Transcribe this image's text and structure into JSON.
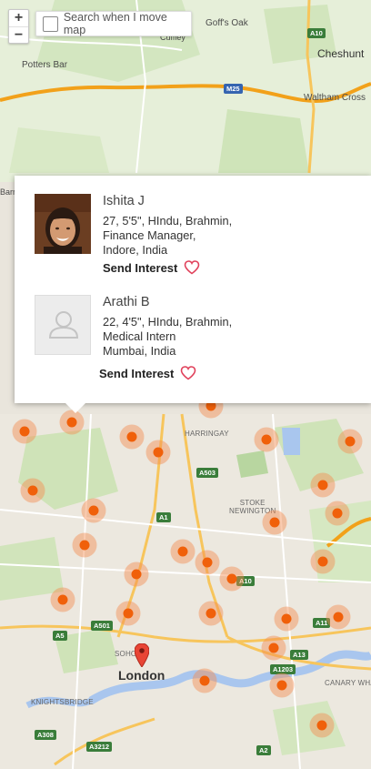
{
  "map_controls": {
    "zoom_in": "+",
    "zoom_out": "−"
  },
  "search": {
    "label": "Search when I move map"
  },
  "popup": {
    "profiles": [
      {
        "name": "Ishita J",
        "details": "27, 5'5\", HIndu, Brahmin,\nFinance Manager,\nIndore, India",
        "action": "Send Interest",
        "has_photo": true
      },
      {
        "name": "Arathi B",
        "details": "22, 4'5\", HIndu, Brahmin,\nMedical Intern\nMumbai, India",
        "action": "Send Interest",
        "has_photo": false
      }
    ]
  },
  "map_labels": {
    "goffs_oak": "Goff's Oak",
    "cuffley": "Cuffley",
    "potters_bar": "Potters Bar",
    "cheshunt": "Cheshunt",
    "waltham_cross": "Waltham Cross",
    "harringay": "HARRINGAY",
    "stoke_newington": "STOKE\nNEWINGTON",
    "soho": "SOHO",
    "london": "London",
    "knightsbridge": "KNIGHTSBRIDGE",
    "canary_wharf": "CANARY WHA",
    "arr": "Barr"
  },
  "road_shields": {
    "a10_top": "A10",
    "m25": "M25",
    "a503": "A503",
    "a1": "A1",
    "a10": "A10",
    "a501": "A501",
    "a5": "A5",
    "a11": "A11",
    "a13": "A13",
    "a1203": "A1203",
    "a308": "A308",
    "a3212": "A3212",
    "a2": "A2"
  },
  "colors": {
    "marker": "#f0600a",
    "heart": "#e0405a",
    "motorway": "#f2a11a",
    "water": "#a9c6ee",
    "park": "#c7dfb0"
  }
}
